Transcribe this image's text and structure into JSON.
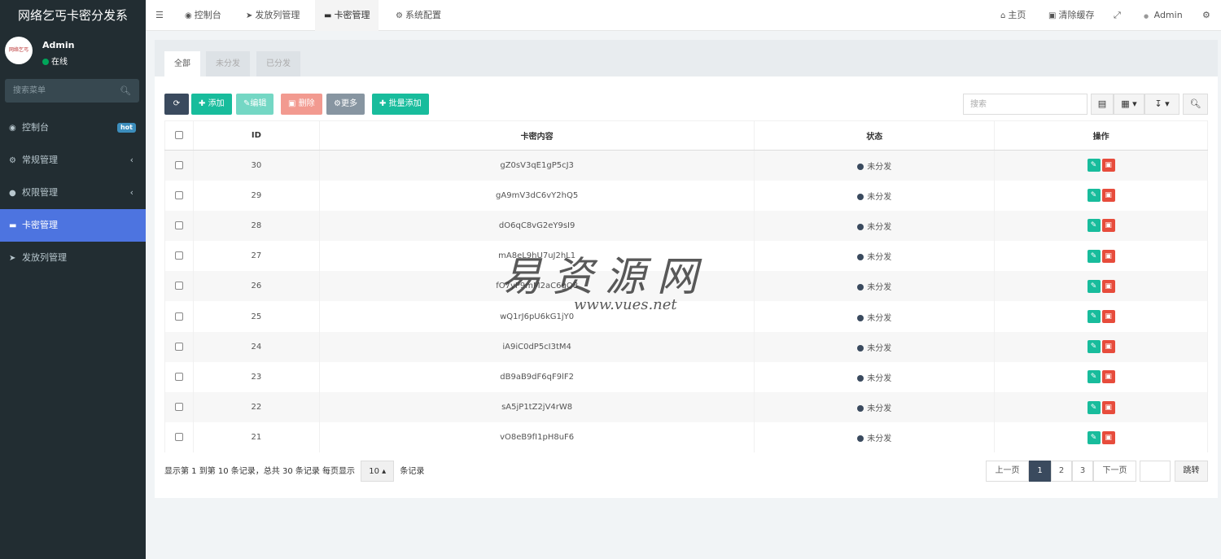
{
  "app": {
    "title": "网络乞丐卡密分发系"
  },
  "user": {
    "avatar_text": "网络乞丐",
    "name": "Admin",
    "status": "在线"
  },
  "sidebar": {
    "search_placeholder": "搜索菜单",
    "items": [
      {
        "label": "控制台",
        "icon": "dashboard-icon",
        "badge": "hot"
      },
      {
        "label": "常规管理",
        "icon": "cogs-icon"
      },
      {
        "label": "权限管理",
        "icon": "group-icon"
      },
      {
        "label": "卡密管理",
        "icon": "card-icon",
        "active": true
      },
      {
        "label": "发放列管理",
        "icon": "paper-plane-icon"
      }
    ]
  },
  "topnav": {
    "tabs": [
      {
        "label": "控制台"
      },
      {
        "label": "发放列管理"
      },
      {
        "label": "卡密管理",
        "active": true
      },
      {
        "label": "系统配置"
      }
    ],
    "home": "主页",
    "clear_cache": "清除缓存",
    "admin": "Admin"
  },
  "filter_tabs": [
    "全部",
    "未分发",
    "已分发"
  ],
  "toolbar": {
    "add": "添加",
    "edit": "编辑",
    "delete": "删除",
    "more": "更多",
    "batch_add": "批量添加",
    "search_placeholder": "搜索"
  },
  "table": {
    "headers": {
      "id": "ID",
      "content": "卡密内容",
      "status": "状态",
      "ops": "操作"
    },
    "rows": [
      {
        "id": "30",
        "content": "gZ0sV3qE1gP5cJ3",
        "status": "未分发"
      },
      {
        "id": "29",
        "content": "gA9mV3dC6vY2hQ5",
        "status": "未分发"
      },
      {
        "id": "28",
        "content": "dO6qC8vG2eY9sI9",
        "status": "未分发"
      },
      {
        "id": "27",
        "content": "mA8eL9hU7uJ2hL1",
        "status": "未分发"
      },
      {
        "id": "26",
        "content": "fO7yP9mM2aC6gQ8",
        "status": "未分发"
      },
      {
        "id": "25",
        "content": "wQ1rJ6pU6kG1jY0",
        "status": "未分发"
      },
      {
        "id": "24",
        "content": "iA9iC0dP5cI3tM4",
        "status": "未分发"
      },
      {
        "id": "23",
        "content": "dB9aB9dF6qF9lF2",
        "status": "未分发"
      },
      {
        "id": "22",
        "content": "sA5jP1tZ2jV4rW8",
        "status": "未分发"
      },
      {
        "id": "21",
        "content": "vO8eB9fI1pH8uF6",
        "status": "未分发"
      }
    ]
  },
  "footer": {
    "info": "显示第 1 到第 10 条记录，总共 30 条记录 每页显示",
    "page_size": "10",
    "suffix": "条记录"
  },
  "pagination": {
    "prev": "上一页",
    "pages": [
      "1",
      "2",
      "3"
    ],
    "current": "1",
    "next": "下一页",
    "goto": "跳转"
  },
  "watermark": {
    "big": "易资源网",
    "small": "www.vues.net"
  },
  "colors": {
    "sidebar_bg": "#222d32",
    "sidebar_active": "#4d74e0",
    "primary_green": "#18bc9c",
    "danger_red": "#e74c3c",
    "dark": "#3a4a5e"
  }
}
